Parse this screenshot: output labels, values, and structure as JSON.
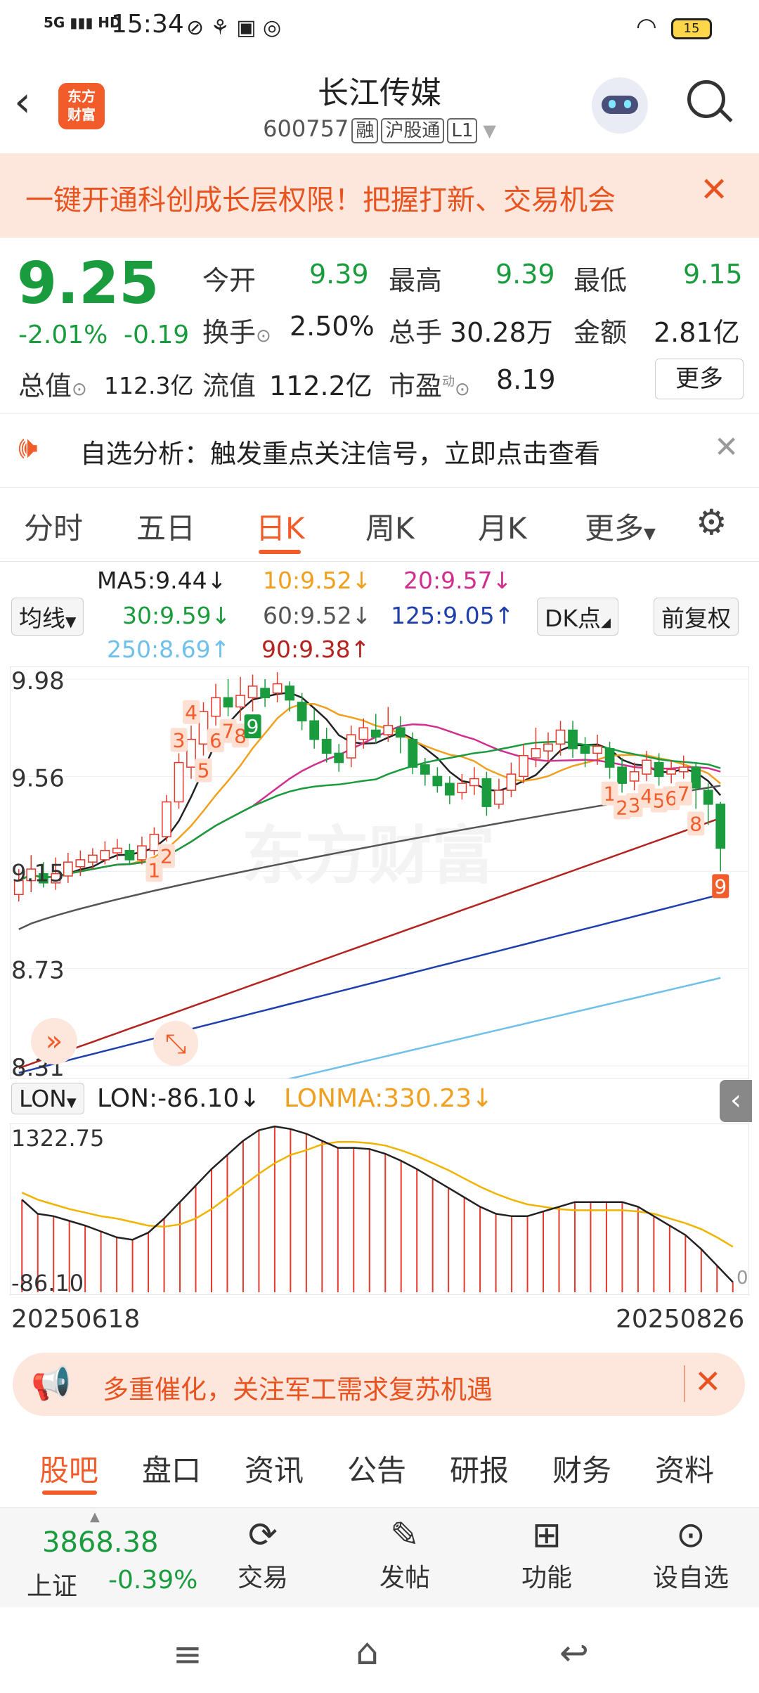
{
  "status_bar": {
    "network": "5G",
    "hd": "HD",
    "time": "15:34",
    "battery": "15"
  },
  "header": {
    "logo_line1": "东方",
    "logo_line2": "财富",
    "title": "长江传媒",
    "code": "600757",
    "tags": [
      "融",
      "沪股通",
      "L1"
    ]
  },
  "banner": {
    "text": "一键开通科创成长层权限！把握打新、交易机会"
  },
  "quote": {
    "price": "9.25",
    "change_pct": "-2.01%",
    "change": "-0.19",
    "open_label": "今开",
    "open": "9.39",
    "high_label": "最高",
    "high": "9.39",
    "low_label": "最低",
    "low": "9.15",
    "turnover_label": "换手",
    "turnover": "2.50%",
    "volume_label": "总手",
    "volume": "30.28万",
    "amount_label": "金额",
    "amount": "2.81亿",
    "mktcap_label": "总值",
    "mktcap": "112.3亿",
    "float_label": "流值",
    "float": "112.2亿",
    "pe_label": "市盈",
    "pe_sup": "动",
    "pe": "8.19",
    "more": "更多"
  },
  "notice": {
    "text": "自选分析：触发重点关注信号，立即点击查看"
  },
  "kline_tabs": {
    "tabs": [
      "分时",
      "五日",
      "日K",
      "周K",
      "月K"
    ],
    "more": "更多",
    "active": "日K"
  },
  "ma_legend": {
    "selector": "均线",
    "ma5": "MA5:9.44↓",
    "ma10": "10:9.52↓",
    "ma20": "20:9.57↓",
    "ma30": "30:9.59↓",
    "ma60": "60:9.52↓",
    "ma125": "125:9.05↑",
    "ma250": "250:8.69↑",
    "ma90": "90:9.38↑",
    "dk": "DK点",
    "fq": "前复权"
  },
  "colors": {
    "up": "#e53a2e",
    "down": "#1a9b3d",
    "ma5": "#222222",
    "ma10": "#f0a01e",
    "ma20": "#d12f8e",
    "ma30": "#1a9b3d",
    "ma60": "#555555",
    "ma125": "#1f3fae",
    "ma250": "#6fc0ea",
    "ma90": "#b3231f",
    "orange": "#f25b2a"
  },
  "chart_data": [
    {
      "type": "candlestick",
      "title": "",
      "y_ticks": [
        "9.98",
        "9.56",
        "9.15",
        "8.73",
        "8.31"
      ],
      "ylim": [
        8.31,
        9.98
      ],
      "candles": [
        [
          9.05,
          9.11,
          9.16,
          9.02
        ],
        [
          9.11,
          9.16,
          9.22,
          9.06
        ],
        [
          9.14,
          9.1,
          9.19,
          9.08
        ],
        [
          9.1,
          9.14,
          9.21,
          9.07
        ],
        [
          9.13,
          9.19,
          9.23,
          9.1
        ],
        [
          9.17,
          9.2,
          9.24,
          9.13
        ],
        [
          9.19,
          9.22,
          9.25,
          9.16
        ],
        [
          9.2,
          9.24,
          9.28,
          9.18
        ],
        [
          9.23,
          9.25,
          9.29,
          9.2
        ],
        [
          9.24,
          9.2,
          9.27,
          9.18
        ],
        [
          9.2,
          9.26,
          9.3,
          9.18
        ],
        [
          9.24,
          9.31,
          9.34,
          9.22
        ],
        [
          9.3,
          9.45,
          9.48,
          9.28
        ],
        [
          9.45,
          9.62,
          9.66,
          9.42
        ],
        [
          9.6,
          9.72,
          9.78,
          9.55
        ],
        [
          9.7,
          9.84,
          9.88,
          9.65
        ],
        [
          9.82,
          9.9,
          9.96,
          9.78
        ],
        [
          9.9,
          9.86,
          9.98,
          9.82
        ],
        [
          9.86,
          9.91,
          9.99,
          9.8
        ],
        [
          9.9,
          9.95,
          10.0,
          9.84
        ],
        [
          9.94,
          9.9,
          9.98,
          9.86
        ],
        [
          9.92,
          9.96,
          10.01,
          9.88
        ],
        [
          9.95,
          9.89,
          9.97,
          9.84
        ],
        [
          9.88,
          9.8,
          9.92,
          9.76
        ],
        [
          9.8,
          9.72,
          9.85,
          9.68
        ],
        [
          9.72,
          9.66,
          9.77,
          9.62
        ],
        [
          9.66,
          9.62,
          9.7,
          9.58
        ],
        [
          9.64,
          9.74,
          9.78,
          9.6
        ],
        [
          9.72,
          9.77,
          9.81,
          9.68
        ],
        [
          9.76,
          9.73,
          9.83,
          9.7
        ],
        [
          9.74,
          9.78,
          9.86,
          9.71
        ],
        [
          9.77,
          9.73,
          9.82,
          9.66
        ],
        [
          9.72,
          9.6,
          9.75,
          9.57
        ],
        [
          9.61,
          9.57,
          9.64,
          9.52
        ],
        [
          9.56,
          9.52,
          9.6,
          9.49
        ],
        [
          9.53,
          9.48,
          9.56,
          9.44
        ],
        [
          9.49,
          9.53,
          9.57,
          9.46
        ],
        [
          9.52,
          9.55,
          9.6,
          9.48
        ],
        [
          9.55,
          9.43,
          9.58,
          9.39
        ],
        [
          9.44,
          9.5,
          9.55,
          9.42
        ],
        [
          9.5,
          9.57,
          9.62,
          9.47
        ],
        [
          9.56,
          9.65,
          9.7,
          9.53
        ],
        [
          9.64,
          9.68,
          9.77,
          9.6
        ],
        [
          9.67,
          9.7,
          9.75,
          9.62
        ],
        [
          9.7,
          9.76,
          9.8,
          9.65
        ],
        [
          9.76,
          9.68,
          9.8,
          9.64
        ],
        [
          9.69,
          9.66,
          9.73,
          9.6
        ],
        [
          9.66,
          9.69,
          9.74,
          9.61
        ],
        [
          9.68,
          9.6,
          9.71,
          9.55
        ],
        [
          9.6,
          9.53,
          9.64,
          9.49
        ],
        [
          9.54,
          9.58,
          9.62,
          9.5
        ],
        [
          9.57,
          9.63,
          9.67,
          9.54
        ],
        [
          9.62,
          9.56,
          9.66,
          9.52
        ],
        [
          9.57,
          9.59,
          9.63,
          9.53
        ],
        [
          9.58,
          9.6,
          9.65,
          9.55
        ],
        [
          9.6,
          9.51,
          9.62,
          9.42
        ],
        [
          9.5,
          9.44,
          9.53,
          9.35
        ],
        [
          9.44,
          9.25,
          9.45,
          9.15
        ]
      ],
      "td_markers": [
        {
          "i": 11,
          "label": "1",
          "above": false
        },
        {
          "i": 12,
          "label": "2",
          "above": false
        },
        {
          "i": 13,
          "label": "3",
          "above": true
        },
        {
          "i": 14,
          "label": "4",
          "above": true
        },
        {
          "i": 15,
          "label": "5",
          "above": false
        },
        {
          "i": 16,
          "label": "6",
          "above": false
        },
        {
          "i": 17,
          "label": "7",
          "above": false
        },
        {
          "i": 18,
          "label": "8",
          "above": false
        },
        {
          "i": 19,
          "label": "9",
          "above": false,
          "highlight": "green"
        },
        {
          "i": 48,
          "label": "1",
          "above": false
        },
        {
          "i": 49,
          "label": "2",
          "above": false
        },
        {
          "i": 50,
          "label": "3",
          "above": false
        },
        {
          "i": 51,
          "label": "4",
          "above": false
        },
        {
          "i": 52,
          "label": "5",
          "above": false
        },
        {
          "i": 53,
          "label": "6",
          "above": false
        },
        {
          "i": 54,
          "label": "7",
          "above": false
        },
        {
          "i": 55,
          "label": "8",
          "above": false
        },
        {
          "i": 57,
          "label": "9",
          "above": false,
          "highlight": "red"
        }
      ]
    },
    {
      "type": "line+bar",
      "title": "",
      "indicator": "LON",
      "y_ticks": [
        "1322.75",
        "-86.10"
      ],
      "ylim": [
        -86.1,
        1322.75
      ],
      "series": [
        {
          "name": "LON",
          "values": [
            700,
            580,
            560,
            520,
            480,
            430,
            380,
            360,
            420,
            540,
            680,
            820,
            960,
            1080,
            1200,
            1290,
            1322,
            1300,
            1260,
            1200,
            1140,
            1140,
            1130,
            1090,
            1030,
            960,
            880,
            800,
            720,
            640,
            580,
            560,
            560,
            600,
            640,
            680,
            680,
            680,
            680,
            640,
            560,
            480,
            400,
            280,
            140,
            0
          ]
        },
        {
          "name": "LONMA",
          "values": [
            760,
            700,
            660,
            620,
            590,
            560,
            540,
            510,
            480,
            470,
            490,
            540,
            620,
            720,
            820,
            920,
            1010,
            1080,
            1120,
            1170,
            1190,
            1190,
            1180,
            1160,
            1120,
            1070,
            1010,
            950,
            880,
            810,
            750,
            700,
            660,
            640,
            620,
            610,
            610,
            610,
            610,
            600,
            580,
            540,
            500,
            450,
            380,
            300
          ]
        }
      ],
      "labels": {
        "selector": "LON",
        "lon": "LON:-86.10↓",
        "lonma": "LONMA:330.23↓",
        "zero": "0"
      }
    }
  ],
  "x_axis": {
    "start": "20250618",
    "end": "20250826"
  },
  "promo": {
    "text": "多重催化，关注军工需求复苏机遇"
  },
  "bottom_tabs": [
    "股吧",
    "盘口",
    "资讯",
    "公告",
    "研报",
    "财务",
    "资料"
  ],
  "footer": {
    "index_value": "3868.38",
    "index_name": "上证",
    "index_change": "-0.39%",
    "buttons": [
      "交易",
      "发帖",
      "功能",
      "设自选"
    ]
  }
}
